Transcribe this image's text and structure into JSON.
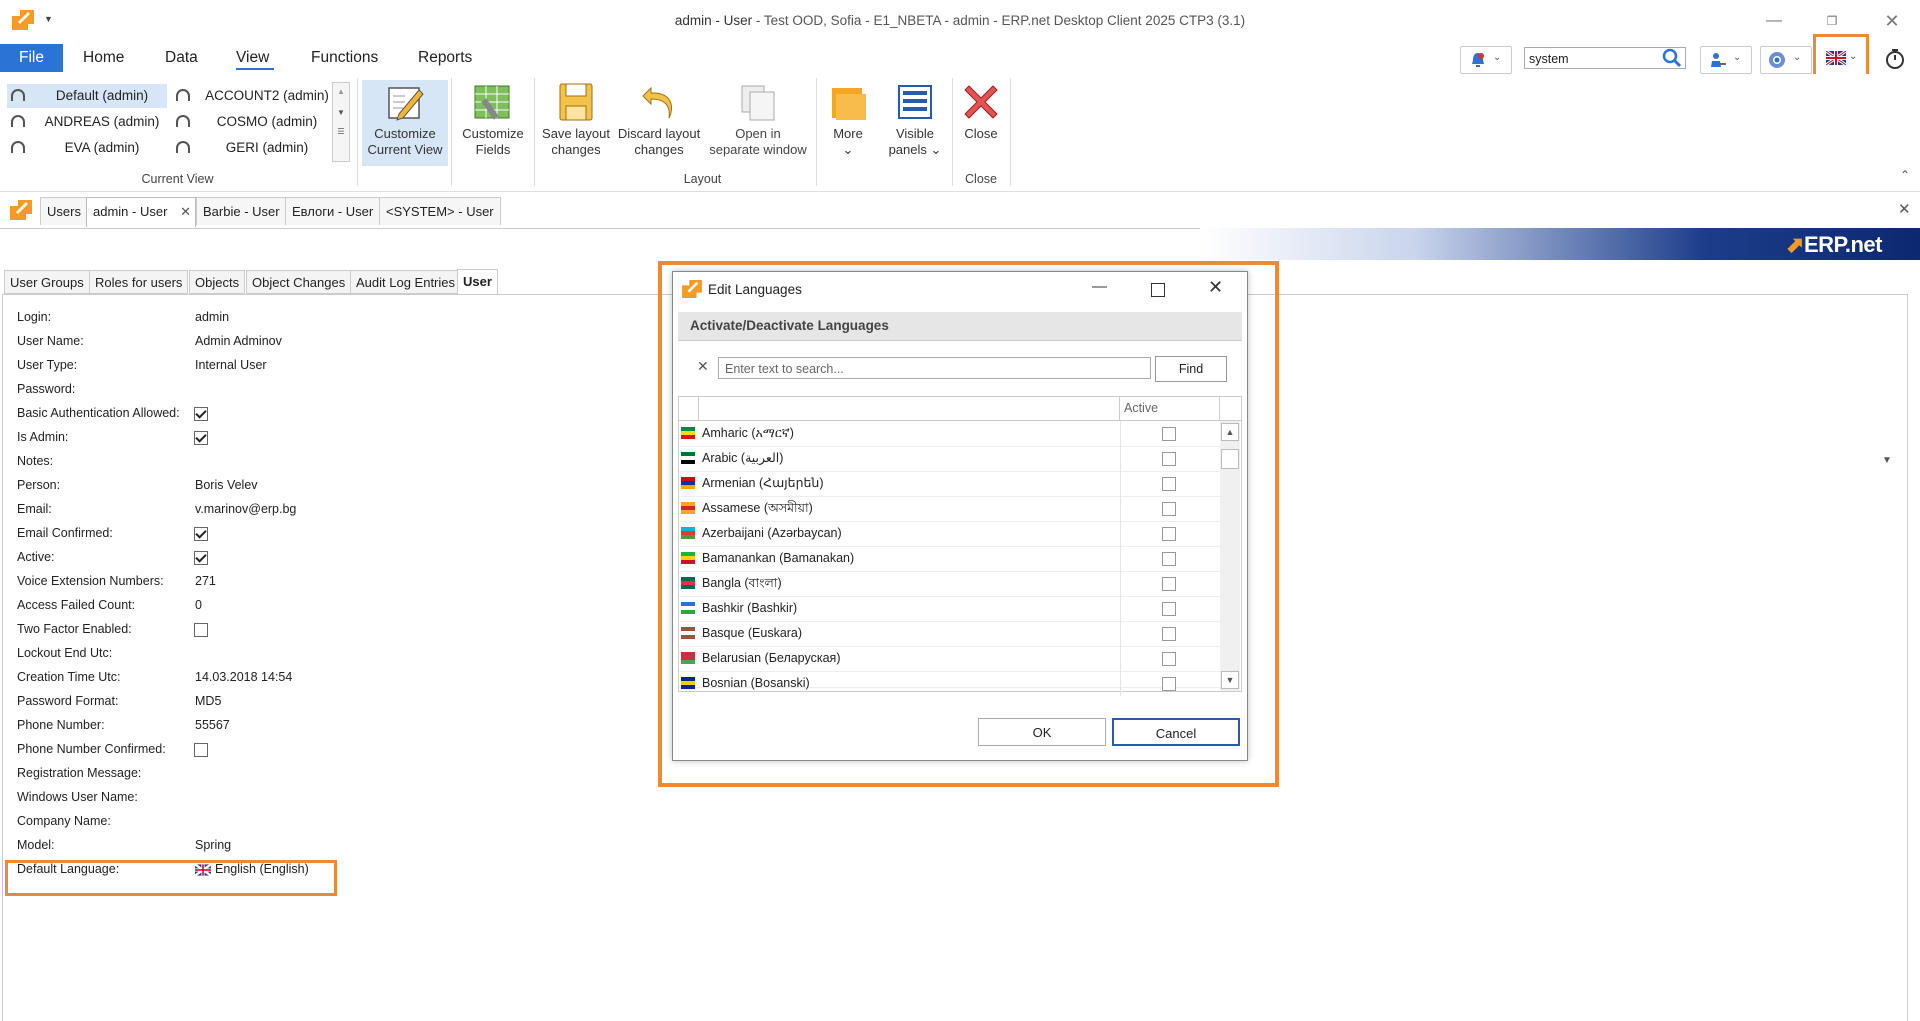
{
  "window": {
    "title_main": "admin - User",
    "title_rest": " - Test OOD, Sofia - E1_NBETA - admin - ERP.net Desktop Client 2025 CTP3 (3.1)"
  },
  "menu": {
    "file": "File",
    "tabs": [
      "Home",
      "Data",
      "View",
      "Functions",
      "Reports"
    ]
  },
  "toolbar": {
    "search_value": "system"
  },
  "current_view": {
    "group_label": "Current View",
    "items": [
      "Default (admin)",
      "ACCOUNT2 (admin)",
      "ANDREAS (admin)",
      "COSMO (admin)",
      "EVA (admin)",
      "GERI (admin)"
    ]
  },
  "ribbon": {
    "customize_view_1": "Customize",
    "customize_view_2": "Current View",
    "customize_fields_1": "Customize",
    "customize_fields_2": "Fields",
    "save_layout_1": "Save layout",
    "save_layout_2": "changes",
    "discard_layout_1": "Discard layout",
    "discard_layout_2": "changes",
    "open_window_1": "Open in",
    "open_window_2": "separate window",
    "more": "More",
    "visible_1": "Visible",
    "visible_2": "panels",
    "close": "Close",
    "layout_group": "Layout",
    "close_group": "Close"
  },
  "doc_tabs": [
    "Users",
    "admin - User",
    "Barbie - User",
    "Евлоги - User",
    "<SYSTEM> - User"
  ],
  "brand": "ERP.net",
  "sub_tabs": [
    "User Groups",
    "Roles for users",
    "Objects",
    "Object Changes",
    "Audit Log Entries",
    "User"
  ],
  "fields": [
    {
      "label": "Login:",
      "value": "admin"
    },
    {
      "label": "User Name:",
      "value": "Admin Adminov"
    },
    {
      "label": "User Type:",
      "value": "Internal User"
    },
    {
      "label": "Password:",
      "value": ""
    },
    {
      "label": "Basic Authentication Allowed:",
      "value": ""
    },
    {
      "label": "Is Admin:",
      "value": ""
    },
    {
      "label": "Notes:",
      "value": ""
    },
    {
      "label": "Person:",
      "value": "Boris Velev"
    },
    {
      "label": "Email:",
      "value": "v.marinov@erp.bg"
    },
    {
      "label": "Email Confirmed:",
      "value": ""
    },
    {
      "label": "Active:",
      "value": ""
    },
    {
      "label": "Voice Extension Numbers:",
      "value": "271"
    },
    {
      "label": "Access Failed Count:",
      "value": "0"
    },
    {
      "label": "Two Factor Enabled:",
      "value": ""
    },
    {
      "label": "Lockout End Utc:",
      "value": ""
    },
    {
      "label": "Creation Time Utc:",
      "value": "14.03.2018 14:54"
    },
    {
      "label": "Password Format:",
      "value": "MD5"
    },
    {
      "label": "Phone Number:",
      "value": "55567"
    },
    {
      "label": "Phone Number Confirmed:",
      "value": ""
    },
    {
      "label": "Registration Message:",
      "value": ""
    },
    {
      "label": "Windows User Name:",
      "value": ""
    },
    {
      "label": "Company Name:",
      "value": ""
    },
    {
      "label": "Model:",
      "value": "Spring"
    },
    {
      "label": "Default Language:",
      "value": "English (English)"
    }
  ],
  "dialog": {
    "title": "Edit Languages",
    "header": "Activate/Deactivate Languages",
    "search_placeholder": "Enter text to search...",
    "find": "Find",
    "col_active": "Active",
    "ok": "OK",
    "cancel": "Cancel",
    "languages": [
      "Amharic (አማርኛ)",
      "Arabic (العربية)",
      "Armenian (Հայերեն)",
      "Assamese (অসমীয়া)",
      "Azerbaijani (Azərbaycan)",
      "Bamanankan (Bamanakan)",
      "Bangla (বাংলা)",
      "Bashkir (Bashkir)",
      "Basque (Euskara)",
      "Belarusian (Беларуская)",
      "Bosnian (Bosanski)"
    ]
  }
}
